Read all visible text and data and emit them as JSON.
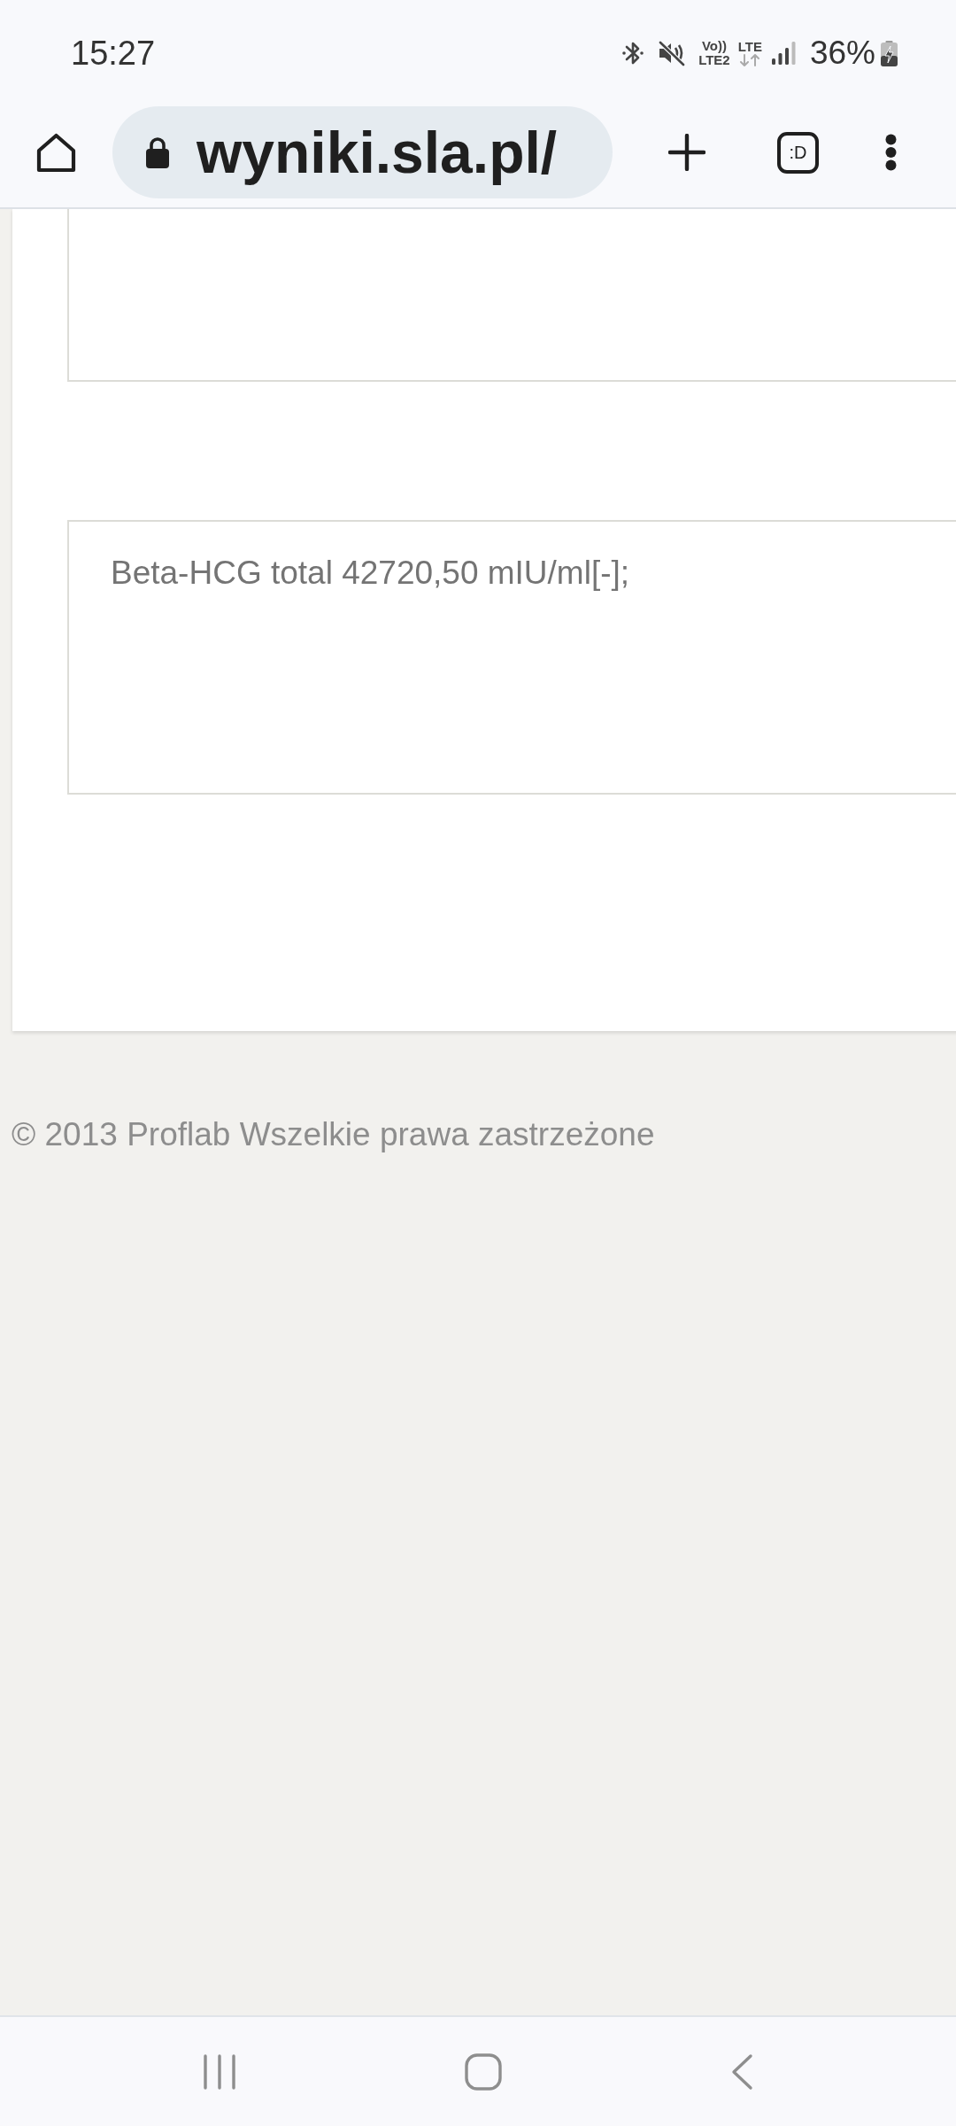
{
  "status_bar": {
    "time": "15:27",
    "volte_label": {
      "top": "Vo))",
      "bottom": "LTE2"
    },
    "data_label": "LTE",
    "battery": "36%"
  },
  "browser_bar": {
    "url": "wyniki.sla.pl/",
    "tab_switcher": ":D"
  },
  "result_boxes": [
    {
      "kind": "cropped"
    },
    {
      "kind": "entry",
      "text": "Beta-HCG total 42720,50 mIU/ml[-];"
    }
  ],
  "footer": {
    "copyright": "© 2013 Proflab Wszelkie prawa zastrzeżone"
  }
}
